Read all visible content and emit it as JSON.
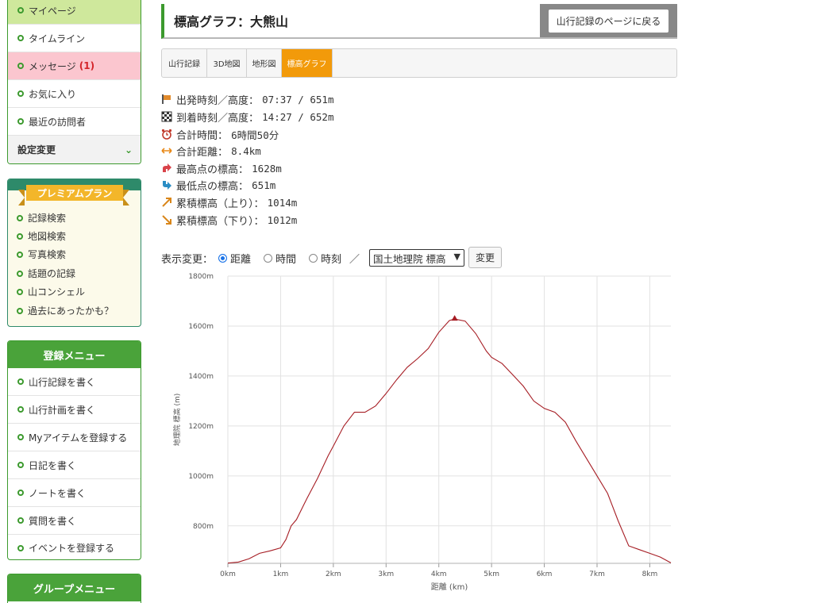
{
  "sidebar": {
    "user_menu": {
      "mypage": "マイページ",
      "timeline": "タイムライン",
      "messages": "メッセージ",
      "message_count": "(1)",
      "favorites": "お気に入り",
      "recent_visitors": "最近の訪問者",
      "settings": "設定変更"
    },
    "premium": {
      "title": "プレミアムプラン",
      "links": [
        "記録検索",
        "地図検索",
        "写真検索",
        "話題の記録",
        "山コンシェル",
        "過去にあったかも？"
      ]
    },
    "register_menu": {
      "title": "登録メニュー",
      "items": [
        "山行記録を書く",
        "山行計画を書く",
        "Myアイテムを登録する",
        "日記を書く",
        "ノートを書く",
        "質問を書く",
        "イベントを登録する"
      ]
    },
    "group_menu": {
      "title": "グループメニュー"
    }
  },
  "header": {
    "title": "標高グラフ：大熊山",
    "back_button": "山行記録のページに戻る"
  },
  "tabs": [
    "山行記録",
    "3D地図",
    "地形図",
    "標高グラフ"
  ],
  "stats": [
    {
      "icon": "start-flag-icon",
      "label": "出発時刻／高度：",
      "value": "07:37 / 651m"
    },
    {
      "icon": "goal-flag-icon",
      "label": "到着時刻／高度：",
      "value": "14:27 / 652m"
    },
    {
      "icon": "alarm-clock-icon",
      "label": "合計時間：",
      "value": "6時間50分"
    },
    {
      "icon": "distance-arrow-icon",
      "label": "合計距離：",
      "value": "8.4km"
    },
    {
      "icon": "highest-point-icon",
      "label": "最高点の標高：",
      "value": "1628m"
    },
    {
      "icon": "lowest-point-icon",
      "label": "最低点の標高：",
      "value": "651m"
    },
    {
      "icon": "ascent-arrow-icon",
      "label": "累積標高（上り）：",
      "value": "1014m"
    },
    {
      "icon": "descent-arrow-icon",
      "label": "累積標高（下り）：",
      "value": "1012m"
    }
  ],
  "controls": {
    "label": "表示変更：",
    "options": [
      "距離",
      "時間",
      "時刻"
    ],
    "selected": "距離",
    "separator": "／",
    "source_select": "国土地理院 標高",
    "change_button": "変更"
  },
  "colors": {
    "green": "#3c9a2e",
    "line": "#a61d24",
    "tab_active": "#f29a0a"
  },
  "chart_data": {
    "type": "line",
    "xlabel": "距離 (km)",
    "ylabel": "地理院 標高 (m)",
    "xlim": [
      0,
      8.4
    ],
    "ylim": [
      650,
      1800
    ],
    "x_ticks": [
      "0km",
      "1km",
      "2km",
      "3km",
      "4km",
      "5km",
      "6km",
      "7km",
      "8km"
    ],
    "y_ticks": [
      "800m",
      "1000m",
      "1200m",
      "1400m",
      "1600m",
      "1800m"
    ],
    "peak": {
      "x": 4.3,
      "y": 1628
    },
    "series": [
      {
        "x": [
          0,
          0.2,
          0.4,
          0.6,
          0.8,
          1.0,
          1.1,
          1.2,
          1.3,
          1.5,
          1.7,
          1.9,
          2.0,
          2.2,
          2.4,
          2.6,
          2.8,
          3.0,
          3.2,
          3.4,
          3.6,
          3.8,
          4.0,
          4.2,
          4.3,
          4.5,
          4.7,
          4.9,
          5.0,
          5.2,
          5.4,
          5.6,
          5.8,
          6.0,
          6.2,
          6.4,
          6.6,
          6.8,
          7.0,
          7.2,
          7.4,
          7.6,
          7.8,
          8.0,
          8.2,
          8.4
        ],
        "y": [
          651,
          655,
          668,
          690,
          700,
          712,
          745,
          800,
          825,
          910,
          990,
          1080,
          1120,
          1200,
          1255,
          1255,
          1280,
          1330,
          1385,
          1435,
          1470,
          1510,
          1575,
          1622,
          1628,
          1620,
          1570,
          1500,
          1475,
          1450,
          1405,
          1360,
          1300,
          1270,
          1255,
          1215,
          1140,
          1070,
          1000,
          930,
          820,
          720,
          705,
          690,
          675,
          652
        ]
      }
    ]
  }
}
